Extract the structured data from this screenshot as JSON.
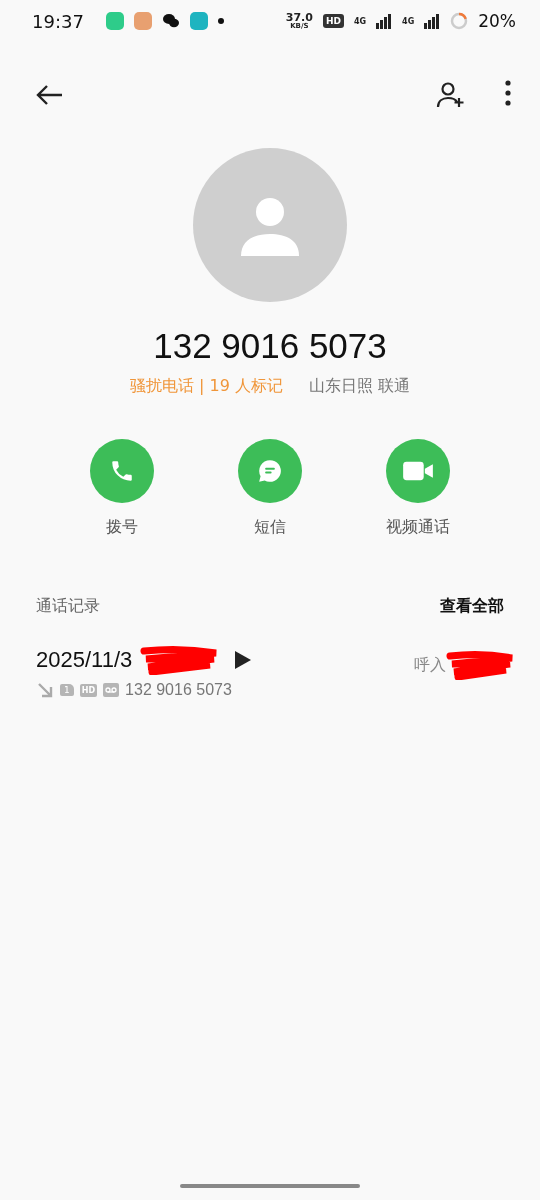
{
  "status_bar": {
    "time": "19:37",
    "speed_value": "37.0",
    "speed_unit": "KB/S",
    "hd": "HD",
    "network_1": "4G",
    "network_2": "4G",
    "battery": {
      "level": 0.2,
      "text": "20%"
    }
  },
  "contact": {
    "number": "132 9016 5073",
    "tag": "骚扰电话 | 19 人标记",
    "location": "山东日照 联通"
  },
  "actions": [
    {
      "kind": "call",
      "label": "拨号"
    },
    {
      "kind": "message",
      "label": "短信"
    },
    {
      "kind": "video",
      "label": "视频通话"
    }
  ],
  "call_log": {
    "title": "通话记录",
    "view_all": "查看全部",
    "entries": [
      {
        "date": "2025/11/3",
        "sim": "1",
        "hd": "HD",
        "number": "132 9016 5073",
        "type": "呼入"
      }
    ]
  }
}
